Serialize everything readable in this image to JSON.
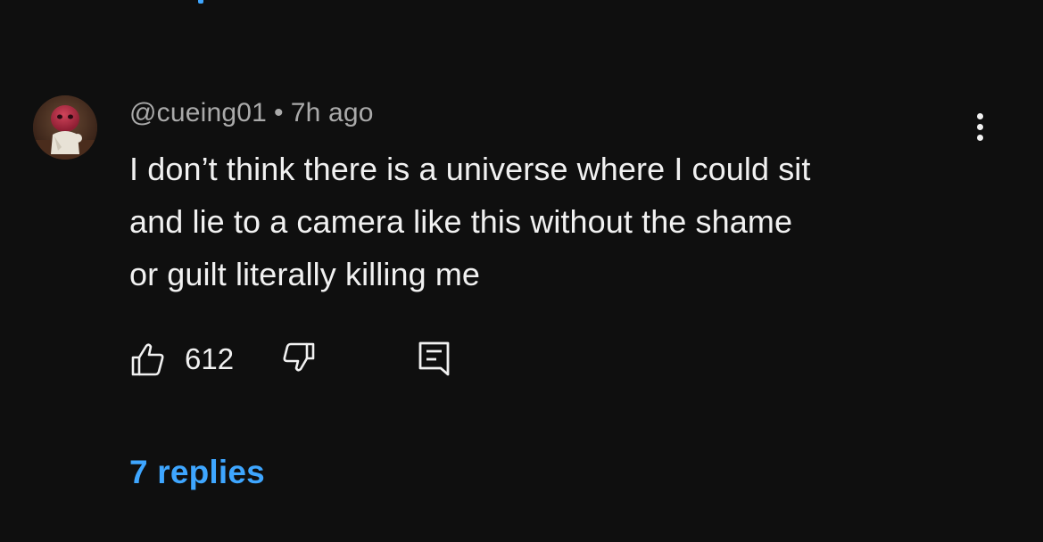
{
  "comment": {
    "author": "@cueing01",
    "separator": "•",
    "time": "7h ago",
    "text_lines": [
      "I don’t think there is a universe where I could sit",
      "and lie to a camera like this without the shame",
      "or guilt literally killing me"
    ],
    "like_count": "612",
    "replies_label": "7 replies",
    "icons": {
      "like": "thumbs-up-icon",
      "dislike": "thumbs-down-icon",
      "reply": "reply-comment-icon",
      "more": "more-vertical-icon"
    }
  },
  "colors": {
    "background": "#0f0f0f",
    "primary_text": "#f1f1f1",
    "secondary_text": "#aaaaaa",
    "link": "#3ea6ff"
  }
}
